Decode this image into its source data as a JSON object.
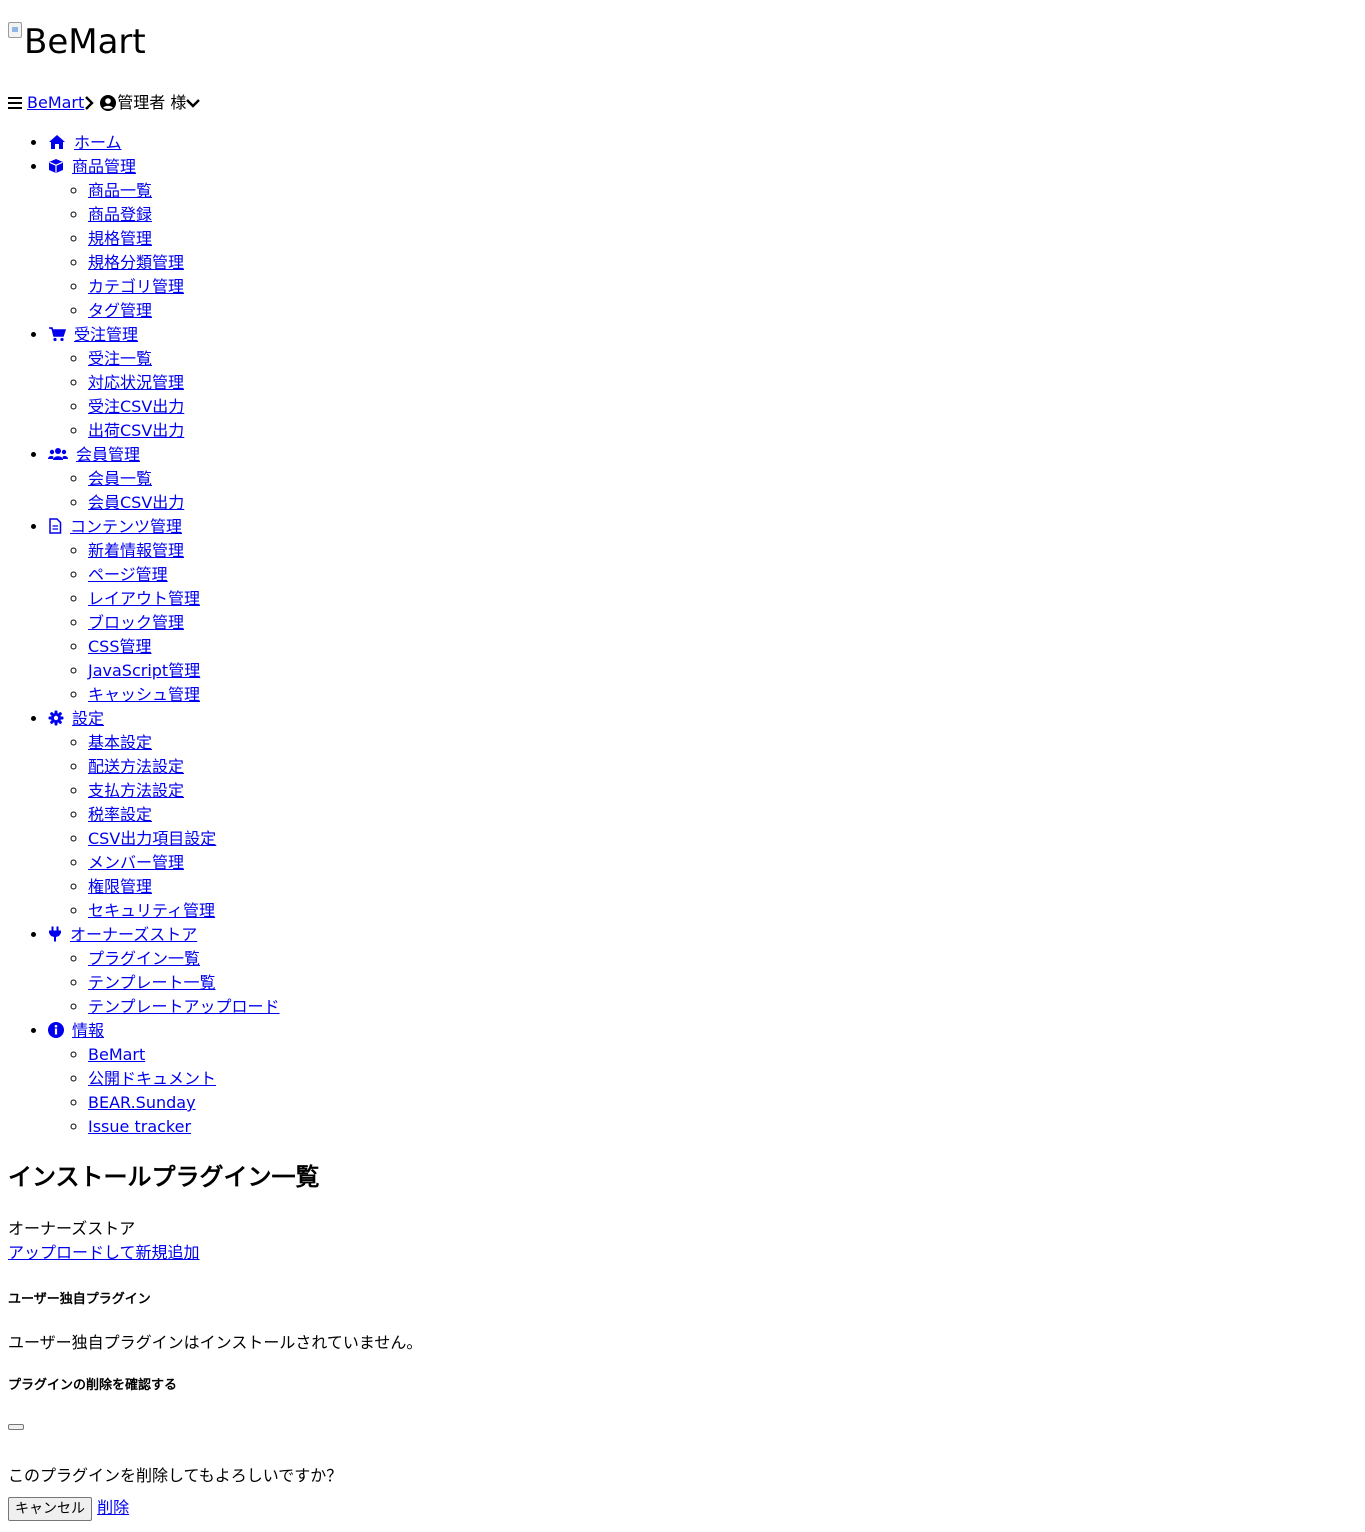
{
  "logo": {
    "alt": "BeMart"
  },
  "topbar": {
    "menu_icon": "bars-icon",
    "brand_link": "BeMart",
    "user_label": "管理者 様"
  },
  "nav": [
    {
      "label": "ホーム",
      "icon": "home-icon",
      "items": []
    },
    {
      "label": "商品管理",
      "icon": "box-icon",
      "items": [
        "商品一覧",
        "商品登録",
        "規格管理",
        "規格分類管理",
        "カテゴリ管理",
        "タグ管理"
      ]
    },
    {
      "label": "受注管理",
      "icon": "cart-icon",
      "items": [
        "受注一覧",
        "対応状況管理",
        "受注CSV出力",
        "出荷CSV出力"
      ]
    },
    {
      "label": "会員管理",
      "icon": "users-icon",
      "items": [
        "会員一覧",
        "会員CSV出力"
      ]
    },
    {
      "label": "コンテンツ管理",
      "icon": "file-icon",
      "items": [
        "新着情報管理",
        "ページ管理",
        "レイアウト管理",
        "ブロック管理",
        "CSS管理",
        "JavaScript管理",
        "キャッシュ管理"
      ]
    },
    {
      "label": "設定",
      "icon": "gear-icon",
      "items": [
        "基本設定",
        "配送方法設定",
        "支払方法設定",
        "税率設定",
        "CSV出力項目設定",
        "メンバー管理",
        "権限管理",
        "セキュリティ管理"
      ]
    },
    {
      "label": "オーナーズストア",
      "icon": "plug-icon",
      "items": [
        "プラグイン一覧",
        "テンプレート一覧",
        "テンプレートアップロード"
      ]
    },
    {
      "label": "情報",
      "icon": "info-icon",
      "items": [
        "BeMart",
        "公開ドキュメント",
        "BEAR.Sunday",
        "Issue tracker"
      ]
    }
  ],
  "main": {
    "title": "インストールプラグイン一覧",
    "breadcrumb": "オーナーズストア",
    "upload_link": "アップロードして新規追加",
    "user_plugins_heading": "ユーザー独自プラグイン",
    "empty_message": "ユーザー独自プラグインはインストールされていません。"
  },
  "modal": {
    "title": "プラグインの削除を確認する",
    "message": "このプラグインを削除してもよろしいですか？",
    "cancel_label": "キャンセル",
    "delete_label": "削除"
  }
}
